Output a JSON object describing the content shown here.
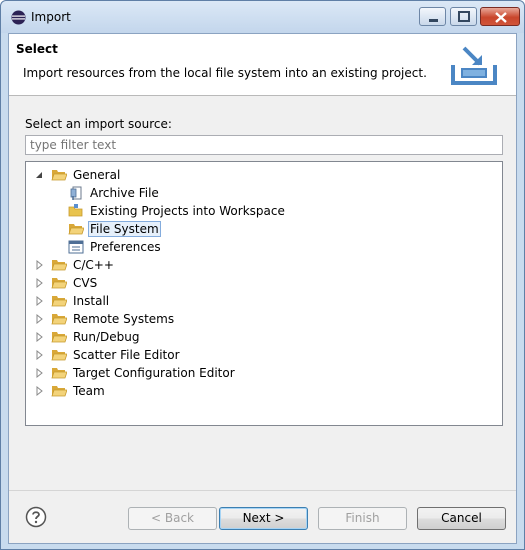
{
  "window": {
    "title": "Import"
  },
  "banner": {
    "title": "Select",
    "description": "Import resources from the local file system into an existing project."
  },
  "source": {
    "label": "Select an import source:",
    "filter_placeholder": "type filter text"
  },
  "tree": {
    "general": {
      "label": "General",
      "children": [
        "Archive File",
        "Existing Projects into Workspace",
        "File System",
        "Preferences"
      ],
      "selected": "File System"
    },
    "categories": [
      "C/C++",
      "CVS",
      "Install",
      "Remote Systems",
      "Run/Debug",
      "Scatter File Editor",
      "Target Configuration Editor",
      "Team"
    ]
  },
  "buttons": {
    "back": "< Back",
    "next": "Next >",
    "finish": "Finish",
    "cancel": "Cancel"
  },
  "colors": {
    "folder": "#e8c34e",
    "selection": "#e6f0fb",
    "close_button": "#c9462c"
  }
}
